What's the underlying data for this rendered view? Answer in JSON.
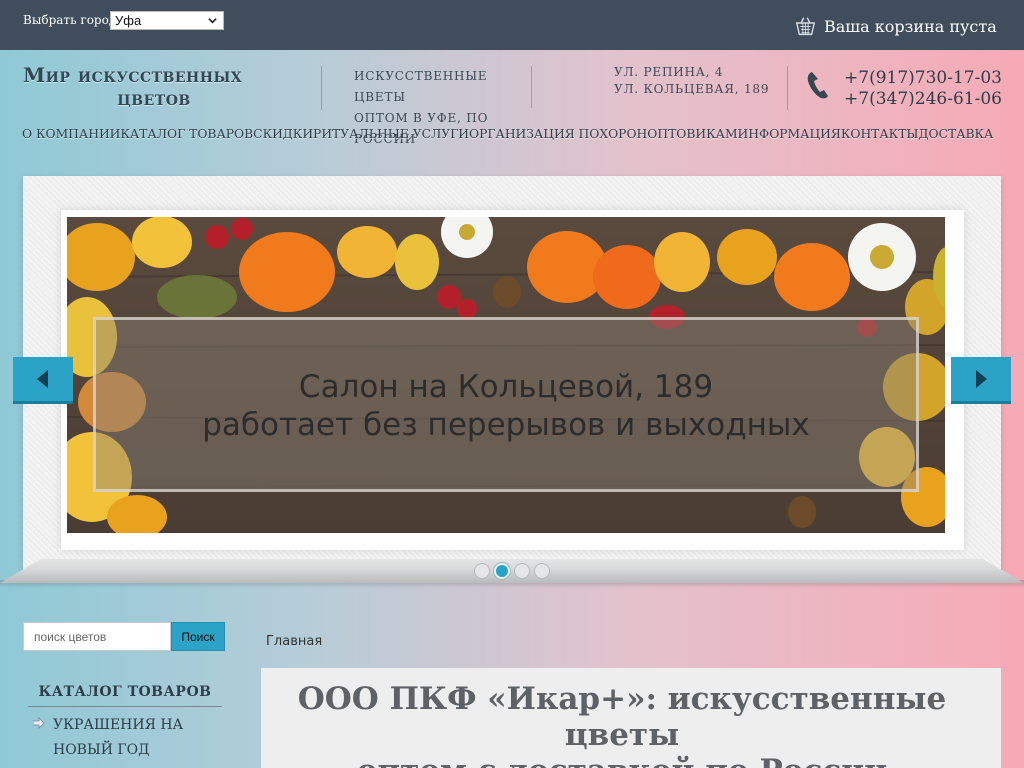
{
  "topbar": {
    "city_label": "Выбрать город:",
    "city_selected": "Уфа",
    "cart_text": "Ваша корзина пуста"
  },
  "header": {
    "logo_line1": "Мир искусственных",
    "logo_line2": "цветов",
    "tagline_line1": "искусственные цветы",
    "tagline_line2": "оптом в Уфе, по России",
    "address_line1": "ул. Репина, 4",
    "address_line2": "ул. Кольцевая, 189",
    "phone1": "+7(917)730-17-03",
    "phone2": "+7(347)246-61-06"
  },
  "nav": {
    "items": [
      "О компании",
      "Каталог товаров",
      "Скидки",
      "Ритуальные услуги",
      "Организация похорон",
      "Оптовикам",
      "Информация",
      "Контакты",
      "Доставка"
    ]
  },
  "slider": {
    "caption_line1": "Салон на Кольцевой, 189",
    "caption_line2": "работает без перерывов и выходных",
    "slides_count": 4,
    "active_index": 1
  },
  "search": {
    "placeholder": "поиск цветов",
    "button_label": "Поиск"
  },
  "sidebar": {
    "catalog_title": "Каталог товаров",
    "items": [
      "Украшения на новый год"
    ]
  },
  "main": {
    "breadcrumb": "Главная",
    "title_line1": "ООО ПКФ «Икар+»: искусственные цветы",
    "title_line2": "оптом с доставкой по России"
  },
  "colors": {
    "topbar": "#3f4d5d",
    "accent": "#2aa3c6",
    "text_dark": "#2f3d48"
  },
  "icons": {
    "cart": "basket-icon",
    "phone": "phone-handset-icon",
    "slider_prev": "chevron-left-icon",
    "slider_next": "chevron-right-icon",
    "city_dropdown": "chevron-down-icon",
    "catalog_bullet": "arrow-right-icon"
  }
}
